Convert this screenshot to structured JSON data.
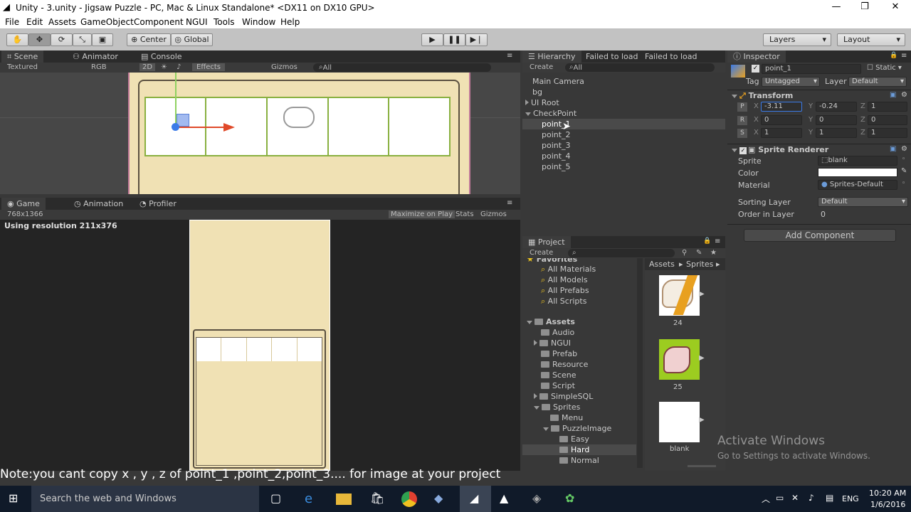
{
  "window": {
    "title": "Unity - 3.unity - Jigsaw Puzzle - PC, Mac & Linux Standalone* <DX11 on DX10 GPU>",
    "minimize": "—",
    "maximize": "❐",
    "close": "✕"
  },
  "menu": [
    "File",
    "Edit",
    "Assets",
    "GameObject",
    "Component",
    "NGUI",
    "Tools",
    "Window",
    "Help"
  ],
  "toolbar": {
    "center": "Center",
    "global": "Global",
    "layers": "Layers",
    "layout": "Layout"
  },
  "scene": {
    "tabs": [
      "Scene",
      "Animator",
      "Console"
    ],
    "textured": "Textured",
    "rgb": "RGB",
    "mode2d": "2D",
    "effects": "Effects",
    "gizmos": "Gizmos",
    "search": "All"
  },
  "game": {
    "tabs": [
      "Game",
      "Animation",
      "Profiler"
    ],
    "resolution": "768x1366",
    "maximize": "Maximize on Play",
    "stats": "Stats",
    "gizmos": "Gizmos",
    "using": "Using resolution 211x376"
  },
  "hierarchy": {
    "tabs": [
      "Hierarchy",
      "Failed to load",
      "Failed to load"
    ],
    "create": "Create",
    "search": "All",
    "items": [
      "Main Camera",
      "bg",
      "UI Root",
      "CheckPoint",
      "point_1",
      "point_2",
      "point_3",
      "point_4",
      "point_5"
    ]
  },
  "project": {
    "tab": "Project",
    "create": "Create",
    "favorites": "Favorites",
    "fav_items": [
      "All Materials",
      "All Models",
      "All Prefabs",
      "All Scripts"
    ],
    "assets": "Assets",
    "folders": [
      "Audio",
      "NGUI",
      "Prefab",
      "Resource",
      "Scene",
      "Script",
      "SimpleSQL",
      "Sprites",
      "Menu",
      "PuzzleImage",
      "Easy",
      "Hard",
      "Normal"
    ],
    "breadcrumb": [
      "Assets",
      "Sprites"
    ],
    "thumbs": [
      "24",
      "25",
      "blank"
    ]
  },
  "inspector": {
    "tab": "Inspector",
    "name": "point_1",
    "static": "Static",
    "tag_label": "Tag",
    "tag": "Untagged",
    "layer_label": "Layer",
    "layer": "Default",
    "transform": "Transform",
    "pos": {
      "x": "-3.11",
      "y": "-0.24",
      "z": "1"
    },
    "rot": {
      "x": "0",
      "y": "0",
      "z": "0"
    },
    "scale": {
      "x": "1",
      "y": "1",
      "z": "1"
    },
    "sprite_renderer": "Sprite Renderer",
    "sprite_label": "Sprite",
    "sprite": "blank",
    "color_label": "Color",
    "material_label": "Material",
    "material": "Sprites-Default",
    "sorting_label": "Sorting Layer",
    "sorting": "Default",
    "order_label": "Order in Layer",
    "order": "0",
    "add_component": "Add Component"
  },
  "watermark": {
    "line1": "Activate Windows",
    "line2": "Go to Settings to activate Windows."
  },
  "note": "Note:you cant copy x , y , z of point_1 ,point_2,point_3.... for image at your project",
  "taskbar": {
    "search": "Search the web and Windows",
    "lang": "ENG",
    "time": "10:20 AM",
    "date": "1/6/2016"
  }
}
